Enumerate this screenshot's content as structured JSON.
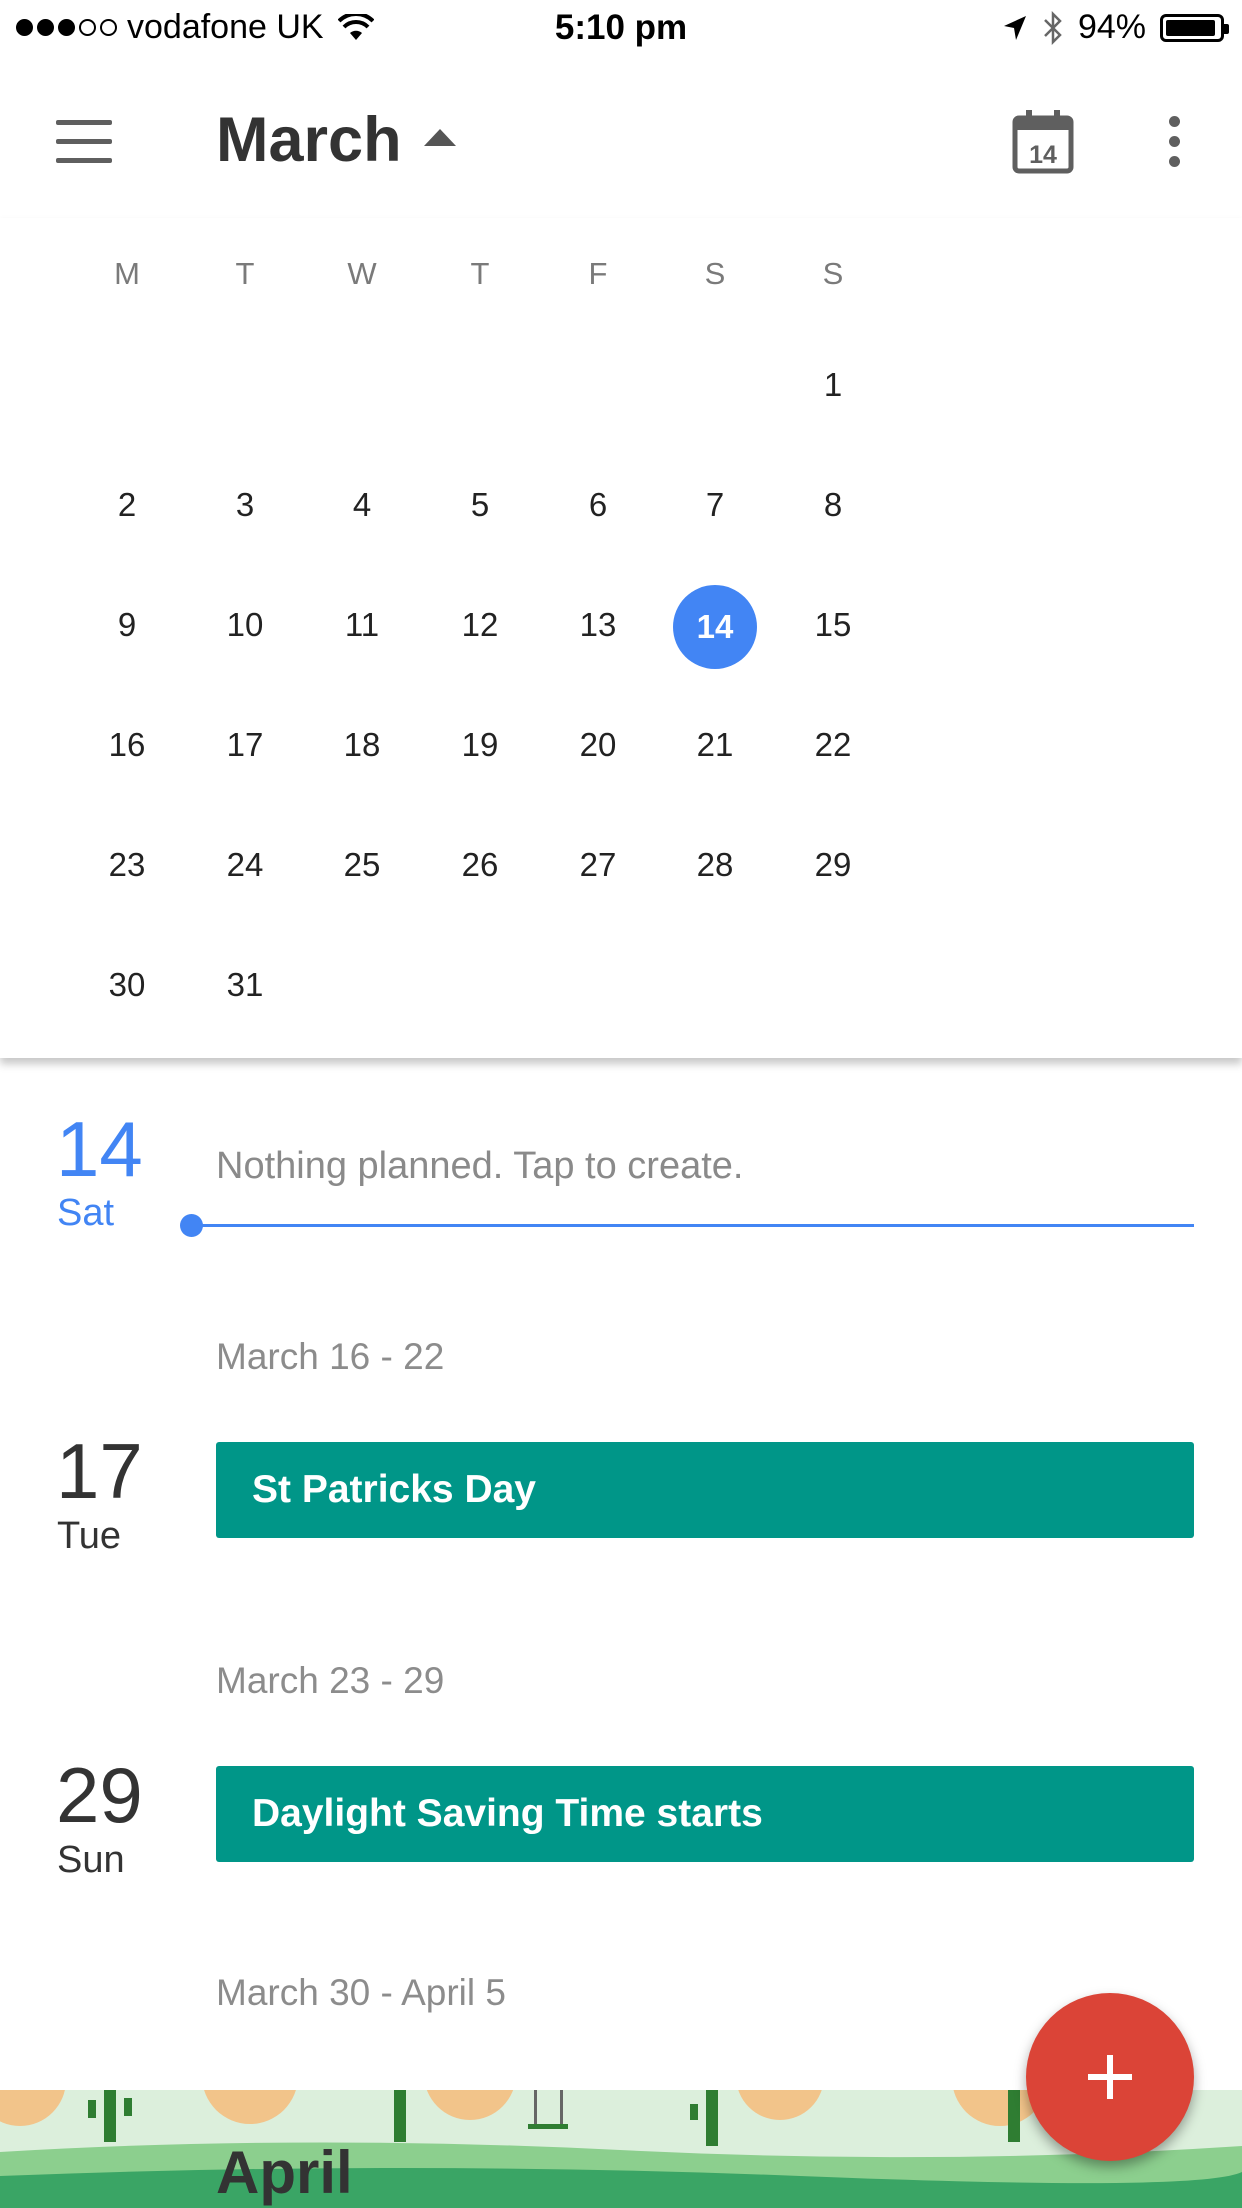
{
  "status_bar": {
    "carrier": "vodafone UK",
    "signal_bars": 3,
    "signal_total": 5,
    "time": "5:10 pm",
    "battery_percent": "94%",
    "battery_level": 0.94
  },
  "app_bar": {
    "menu_icon": "hamburger-menu-icon",
    "month_title": "March",
    "today_icon_date": "14",
    "overflow_icon": "more-vert-icon"
  },
  "calendar": {
    "weekdays": [
      "M",
      "T",
      "W",
      "T",
      "F",
      "S",
      "S"
    ],
    "weeks": [
      [
        "",
        "",
        "",
        "",
        "",
        "",
        "1"
      ],
      [
        "2",
        "3",
        "4",
        "5",
        "6",
        "7",
        "8"
      ],
      [
        "9",
        "10",
        "11",
        "12",
        "13",
        "14",
        "15"
      ],
      [
        "16",
        "17",
        "18",
        "19",
        "20",
        "21",
        "22"
      ],
      [
        "23",
        "24",
        "25",
        "26",
        "27",
        "28",
        "29"
      ],
      [
        "30",
        "31",
        "",
        "",
        "",
        "",
        ""
      ]
    ],
    "selected_day": "14"
  },
  "agenda": {
    "today": {
      "day_number": "14",
      "weekday": "Sat",
      "placeholder": "Nothing planned. Tap to create."
    },
    "sections": [
      {
        "week_label": "March 16 - 22",
        "day_number": "17",
        "weekday": "Tue",
        "event": "St Patricks Day"
      },
      {
        "week_label": "March 23 - 29",
        "day_number": "29",
        "weekday": "Sun",
        "event": "Daylight Saving Time starts"
      }
    ],
    "next_week_label": "March 30 - April 5",
    "next_month_banner": "April"
  },
  "colors": {
    "accent_blue": "#4285f4",
    "event_teal": "#009688",
    "fab_red": "#db4437"
  },
  "fab": {
    "icon": "plus-icon"
  }
}
